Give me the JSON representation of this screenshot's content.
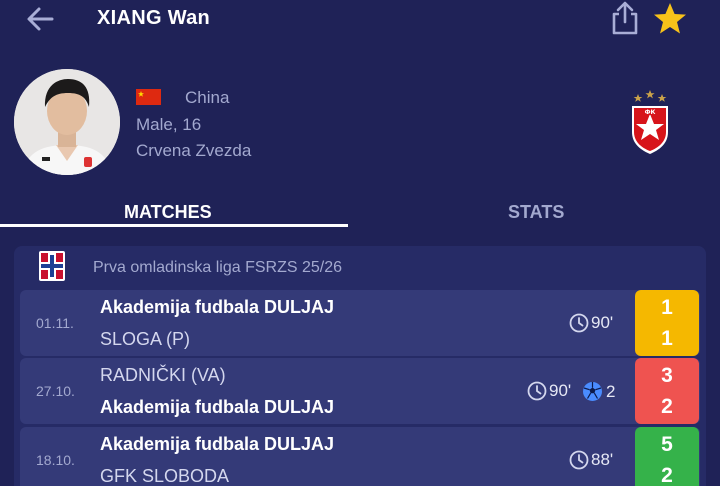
{
  "header": {
    "title": "XIANG Wan"
  },
  "player": {
    "country": "China",
    "gender_age": "Male, 16",
    "club": "Crvena Zvezda"
  },
  "tabs": [
    {
      "label": "MATCHES",
      "active": true
    },
    {
      "label": "STATS",
      "active": false
    }
  ],
  "league": {
    "name": "Prva omladinska liga FSRZS 25/26"
  },
  "matches": [
    {
      "date": "01.11.",
      "home": "Akademija fudbala DULJAJ",
      "away": "SLOGA (P)",
      "minutes": "90'",
      "goals": "",
      "score_home": "1",
      "score_away": "1",
      "result": "draw"
    },
    {
      "date": "27.10.",
      "home": "RADNIČKI (VA)",
      "away": "Akademija fudbala DULJAJ",
      "minutes": "90'",
      "goals": "2",
      "score_home": "3",
      "score_away": "2",
      "result": "loss"
    },
    {
      "date": "18.10.",
      "home": "Akademija fudbala DULJAJ",
      "away": "GFK SLOBODA",
      "minutes": "88'",
      "goals": "",
      "score_home": "5",
      "score_away": "2",
      "result": "win"
    }
  ],
  "colors": {
    "background": "#1f2257",
    "card": "#262b66",
    "row": "#343a78",
    "draw": "#f5b800",
    "loss": "#ef5350",
    "win": "#35b24a",
    "favorite": "#f7c21a"
  },
  "icons": {
    "back": "arrow-left-icon",
    "share": "share-icon",
    "favorite": "star-icon",
    "minutes": "clock-icon",
    "goals": "football-icon"
  }
}
